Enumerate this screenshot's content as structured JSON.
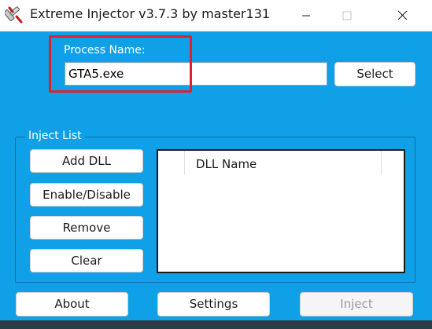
{
  "window": {
    "title": "Extreme Injector v3.7.3 by master131",
    "icons": {
      "app": "syringe-icon",
      "minimize": "minimize-icon",
      "maximize": "maximize-icon",
      "close": "close-icon"
    }
  },
  "process": {
    "label": "Process Name:",
    "value": "GTA5.exe",
    "select_label": "Select"
  },
  "inject_list": {
    "legend": "Inject List",
    "buttons": {
      "add": "Add DLL",
      "enable_disable": "Enable/Disable",
      "remove": "Remove",
      "clear": "Clear"
    },
    "columns": [
      "",
      "DLL Name"
    ],
    "rows": []
  },
  "footer": {
    "about_label": "About",
    "settings_label": "Settings",
    "inject_label": "Inject",
    "inject_enabled": false
  },
  "colors": {
    "background": "#0fa0e8",
    "highlight": "#e0202a",
    "titlebar": "#ffffff"
  }
}
